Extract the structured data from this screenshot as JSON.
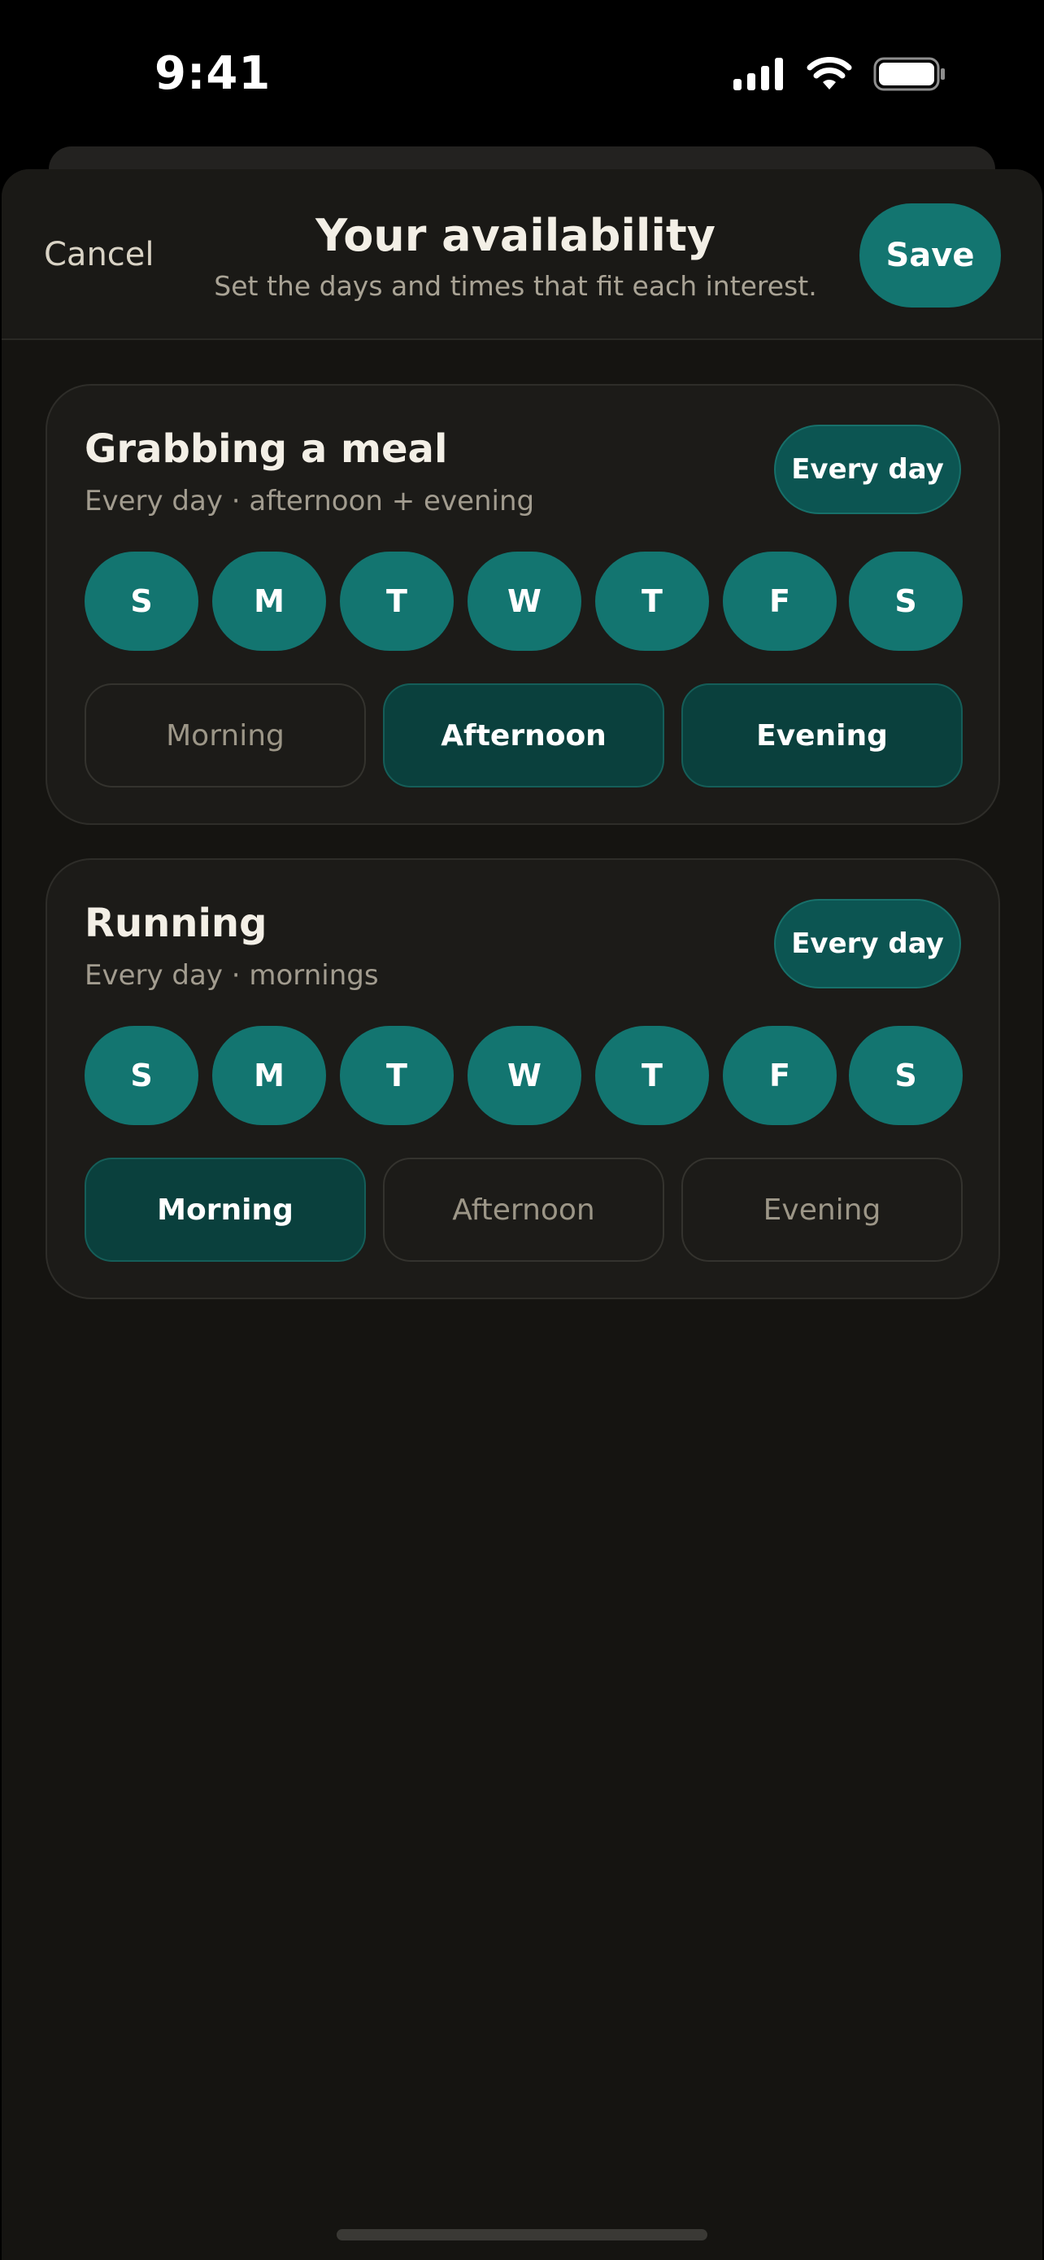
{
  "status_bar": {
    "time": "9:41",
    "icons": [
      "cellular-signal-icon",
      "wifi-icon",
      "battery-icon"
    ]
  },
  "header": {
    "cancel_label": "Cancel",
    "title": "Your availability",
    "subtitle": "Set the days and times that fit each interest.",
    "save_label": "Save"
  },
  "interests": [
    {
      "title": "Grabbing a meal",
      "summary": "Every day · afternoon + evening",
      "every_day_label": "Every day",
      "days": [
        "S",
        "M",
        "T",
        "W",
        "T",
        "F",
        "S"
      ],
      "days_selected": [
        true,
        true,
        true,
        true,
        true,
        true,
        true
      ],
      "times": [
        {
          "label": "Morning",
          "selected": false
        },
        {
          "label": "Afternoon",
          "selected": true
        },
        {
          "label": "Evening",
          "selected": true
        }
      ]
    },
    {
      "title": "Running",
      "summary": "Every day · mornings",
      "every_day_label": "Every day",
      "days": [
        "S",
        "M",
        "T",
        "W",
        "T",
        "F",
        "S"
      ],
      "days_selected": [
        true,
        true,
        true,
        true,
        true,
        true,
        true
      ],
      "times": [
        {
          "label": "Morning",
          "selected": true
        },
        {
          "label": "Afternoon",
          "selected": false
        },
        {
          "label": "Evening",
          "selected": false
        }
      ]
    }
  ],
  "colors": {
    "accent": "#137570",
    "accent_dark": "#0a403d",
    "sheet_background": "#151411",
    "card_background": "#1c1b18"
  }
}
